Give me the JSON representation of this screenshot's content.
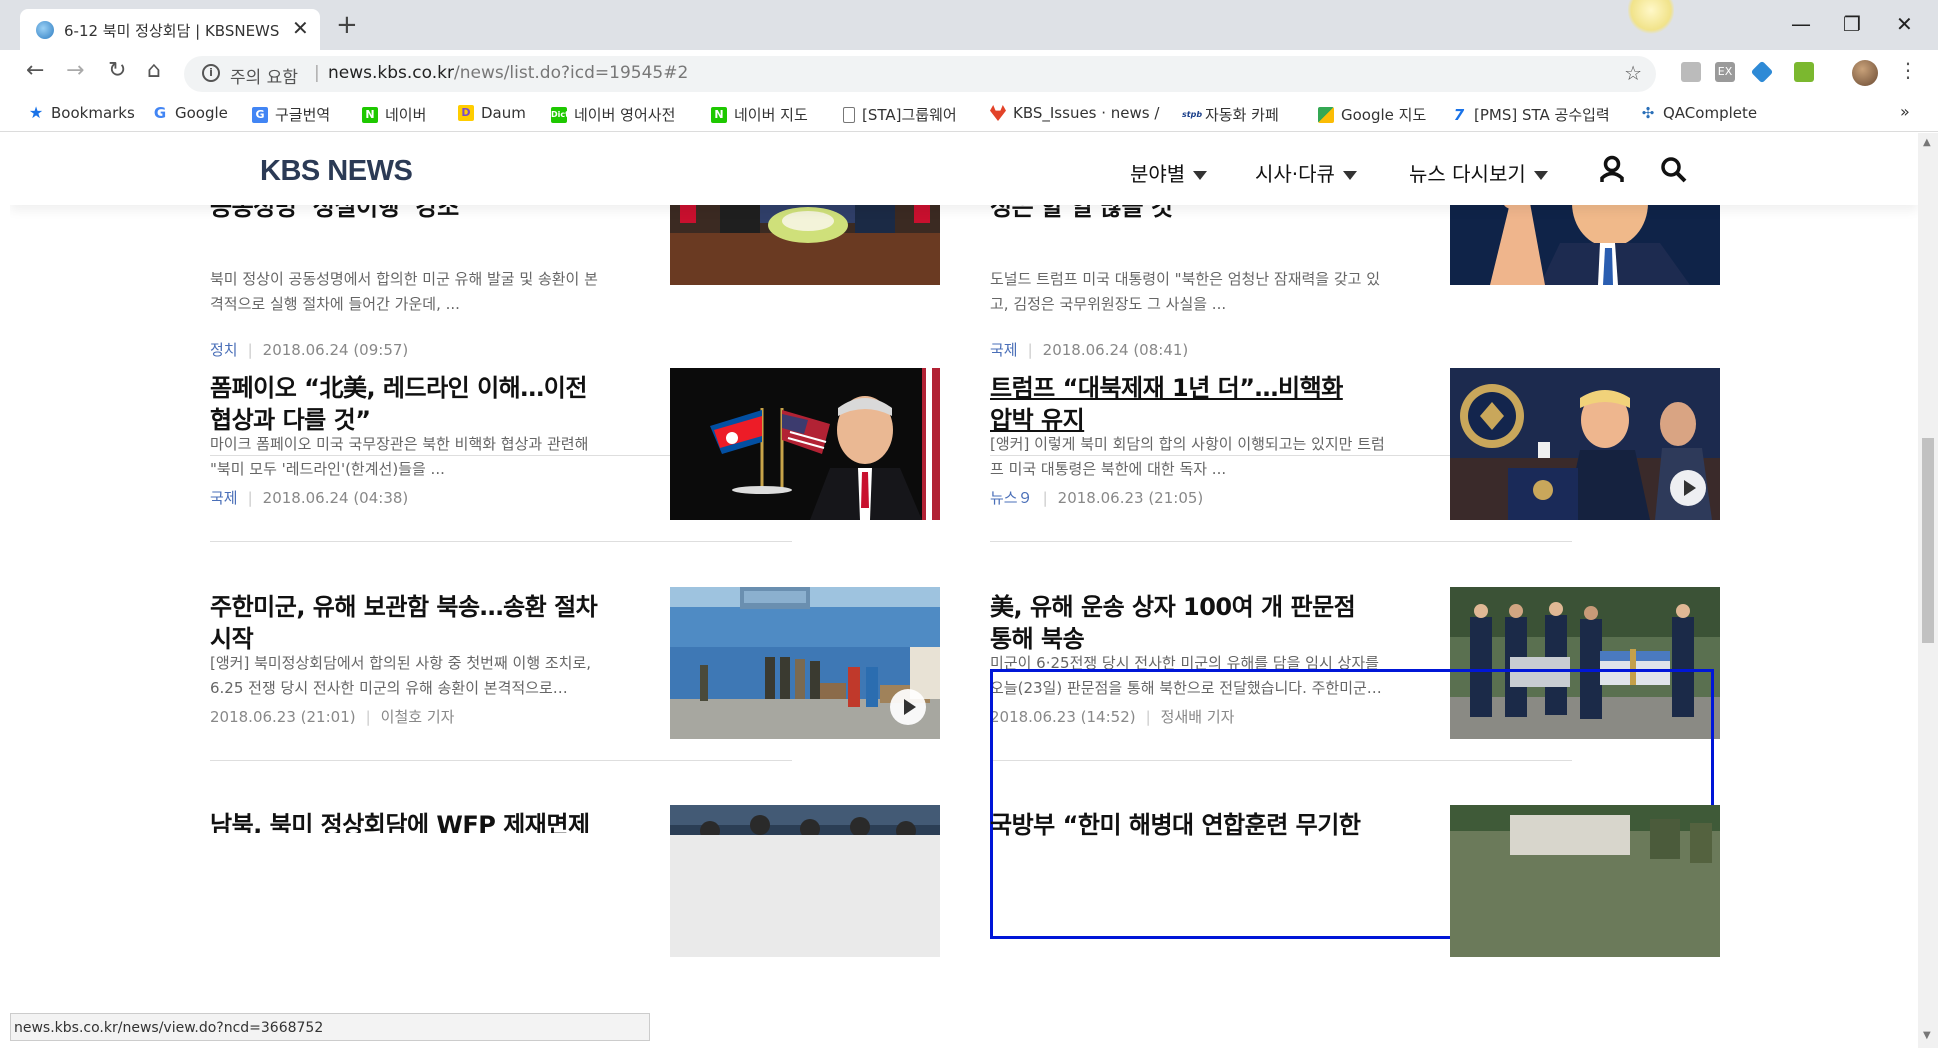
{
  "browser": {
    "tab_title": "6-12 북미 정상회담 | KBSNEWS",
    "tab_close": "✕",
    "new_tab": "+",
    "window_controls": [
      "—",
      "❐",
      "✕"
    ],
    "nav": {
      "back": "←",
      "forward": "→",
      "reload": "↻",
      "home": "⌂"
    },
    "security_text": "주의 요함",
    "url_host": "news.kbs.co.kr",
    "url_path": "/news/list.do?icd=19545#2",
    "bookmark_star": "☆",
    "menu_dots": "⋮",
    "bookmarks": [
      {
        "label": "Bookmarks",
        "icon": "star-icon"
      },
      {
        "label": "Google",
        "icon": "google-icon"
      },
      {
        "label": "구글번역",
        "icon": "translate-icon"
      },
      {
        "label": "네이버",
        "icon": "naver-icon"
      },
      {
        "label": "Daum",
        "icon": "daum-icon"
      },
      {
        "label": "네이버 영어사전",
        "icon": "dict-icon"
      },
      {
        "label": "네이버 지도",
        "icon": "naver-icon"
      },
      {
        "label": "[STA]그룹웨어",
        "icon": "page-icon"
      },
      {
        "label": "KBS_Issues · news / ",
        "icon": "gitlab-icon"
      },
      {
        "label": "자동화 카페",
        "icon": "cafe-icon"
      },
      {
        "label": "Google 지도",
        "icon": "maps-icon"
      },
      {
        "label": "[PMS] STA 공수입력",
        "icon": "pms-icon"
      },
      {
        "label": "QAComplete",
        "icon": "qa-icon"
      }
    ],
    "bookmarks_overflow": "»",
    "status_url": "news.kbs.co.kr/news/view.do?ncd=3668752"
  },
  "site": {
    "logo": "KBS NEWS",
    "menu": [
      "분야별",
      "시사·다큐",
      "뉴스 다시보기"
    ]
  },
  "articles": [
    {
      "title": "미군유해 송환 돌입 속 北선전매체, 공동성명 ‘성실이행’ 강조",
      "summary": "북미 정상이 공동성명에서 합의한 미군 유해 발굴 및 송환이 본격적으로 실행 절차에 들어간 가운데, ...",
      "category": "정치",
      "date": "2018.06.24 (09:57)",
      "reporter": ""
    },
    {
      "title": "트럼프 “北, 큰 잠재력 가져…김정은 할 일 많을 것”",
      "summary": "도널드 트럼프 미국 대통령이 \"북한은 엄청난 잠재력을 갖고 있고, 김정은 국무위원장도 그 사실을 ...",
      "category": "국제",
      "date": "2018.06.24 (08:41)",
      "reporter": ""
    },
    {
      "title": "폼페이오 “北美, 레드라인 이해…이전 협상과 다를 것”",
      "summary": "마이크 폼페이오 미국 국무장관은 북한 비핵화 협상과 관련해 \"북미 모두 '레드라인'(한계선)들을 ...",
      "category": "국제",
      "date": "2018.06.24 (04:38)",
      "reporter": ""
    },
    {
      "title": "트럼프 “대북제재 1년 더”…비핵화 압박 유지",
      "summary": "[앵커] 이렇게 북미 회담의 합의 사항이 이행되고는 있지만 트럼프 미국 대통령은 북한에 대한 독자 ...",
      "category": "뉴스９",
      "date": "2018.06.23 (21:05)",
      "reporter": ""
    },
    {
      "title": "주한미군, 유해 보관함 북송…송환 절차 시작",
      "summary": "[앵커] 북미정상회담에서 합의된 사항 중 첫번째 이행 조치로, 6.25 전쟁 당시 전사한 미군의 유해 송환이 본격적으로…",
      "category": "",
      "date": "2018.06.23 (21:01)",
      "reporter": "이철호 기자"
    },
    {
      "title": "美, 유해 운송 상자 100여 개 판문점 통해 북송",
      "summary": "미군이 6·25전쟁 당시 전사한 미군의 유해를 담을 임시 상자를 오늘(23일) 판문점을 통해 북한으로 전달했습니다. 주한미군…",
      "category": "",
      "date": "2018.06.23 (14:52)",
      "reporter": "정새배 기자"
    },
    {
      "title": "남북, 북미 정상회담에 WFP 제재면제 요구",
      "summary": "",
      "category": "",
      "date": "",
      "reporter": ""
    },
    {
      "title": "국방부 “한미 해병대 연합훈련 무기한",
      "summary": "",
      "category": "",
      "date": "",
      "reporter": ""
    }
  ],
  "colors": {
    "accent_link": "#4a6fb8",
    "highlight_border": "#0016d8",
    "logo": "#2b3a55"
  }
}
